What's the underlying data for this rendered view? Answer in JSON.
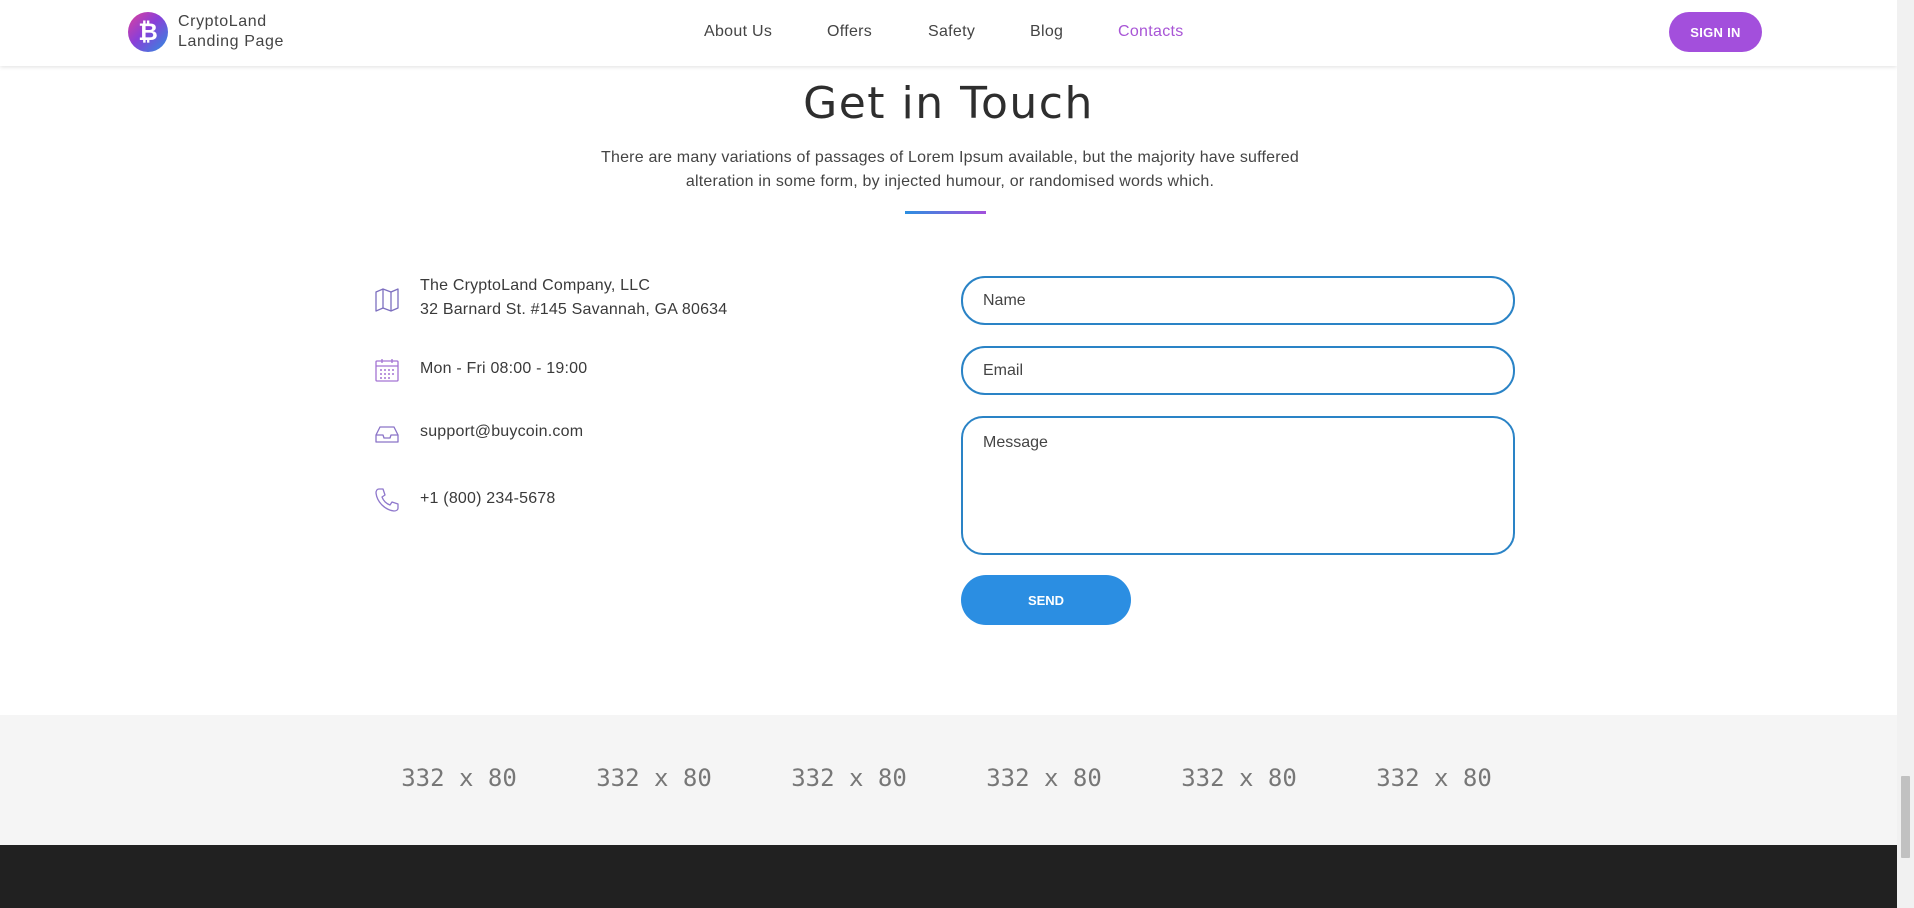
{
  "brand": {
    "line1": "CryptoLand",
    "line2": "Landing Page",
    "logo_glyph": "₿"
  },
  "nav": [
    {
      "label": "About Us",
      "active": false
    },
    {
      "label": "Offers",
      "active": false
    },
    {
      "label": "Safety",
      "active": false
    },
    {
      "label": "Blog",
      "active": false
    },
    {
      "label": "Contacts",
      "active": true
    }
  ],
  "header": {
    "signin_label": "SIGN IN"
  },
  "contact": {
    "title": "Get in Touch",
    "subtitle_line1": "There are many variations of passages of Lorem Ipsum available, but the majority have suffered",
    "subtitle_line2": "alteration in some form, by injected humour, or randomised words which.",
    "company": "The CryptoLand Company, LLC",
    "address": "32 Barnard St. #145 Savannah, GA 80634",
    "hours": "Mon - Fri 08:00 - 19:00",
    "email": "support@buycoin.com",
    "phone": "+1 (800) 234-5678",
    "icons": [
      "map-icon",
      "calendar-icon",
      "inbox-icon",
      "phone-icon"
    ]
  },
  "form": {
    "name_placeholder": "Name",
    "email_placeholder": "Email",
    "message_placeholder": "Message",
    "send_label": "SEND"
  },
  "partners": [
    "332 x 80",
    "332 x 80",
    "332 x 80",
    "332 x 80",
    "332 x 80",
    "332 x 80"
  ],
  "colors": {
    "accent_purple": "#a34fdc",
    "accent_blue": "#2b8ee2",
    "field_border": "#2a83c6",
    "footer": "#212121"
  }
}
